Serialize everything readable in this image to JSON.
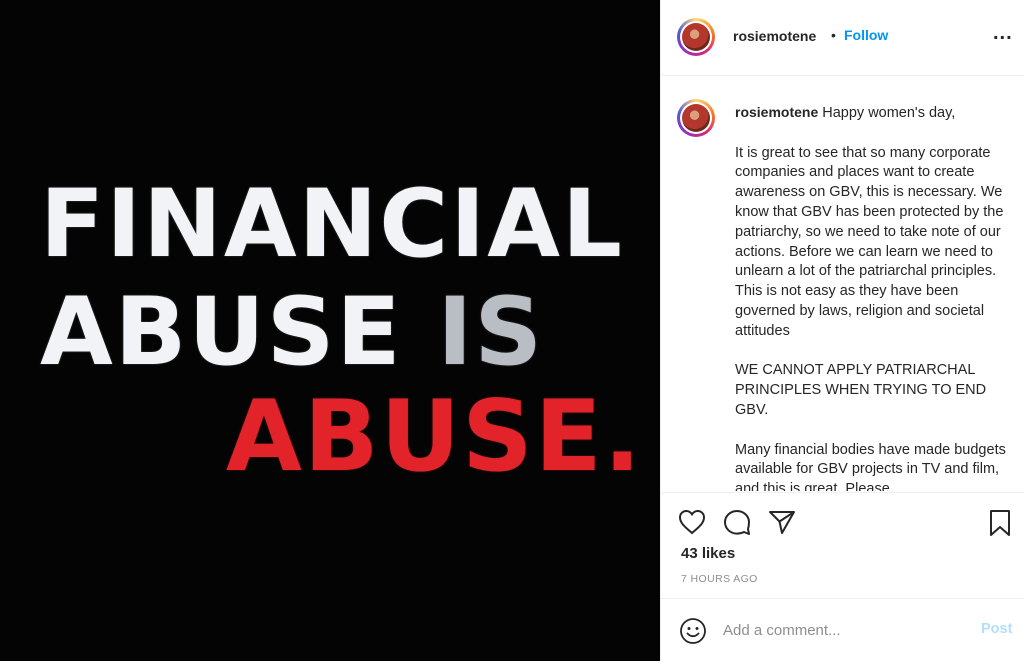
{
  "post_image": {
    "line1": "FINANCIAL",
    "line2_a": "ABUSE ",
    "line2_b": "IS",
    "line3": "ABUSE."
  },
  "header": {
    "username": "rosiemotene",
    "separator": "•",
    "follow_label": "Follow",
    "more_label": "..."
  },
  "caption": {
    "username": "rosiemotene",
    "paragraphs": [
      "Happy women's day,",
      "It is great to see that so many corporate companies and places want to create awareness on GBV, this is necessary. We know that GBV has been protected by the patriarchy, so we need to take note of our actions. Before we can learn we need to unlearn a lot of the patriarchal principles. This is not easy as they have been governed by laws, religion and societal attitudes",
      "WE CANNOT APPLY PATRIARCHAL PRINCIPLES WHEN TRYING TO END GBV.",
      "Many financial bodies have made budgets available for GBV projects in TV and film, and this is great. Please"
    ]
  },
  "actions": {
    "likes": "43 likes",
    "timestamp": "7 HOURS AGO",
    "icons": [
      "heart-icon",
      "comment-icon",
      "share-icon",
      "bookmark-icon"
    ]
  },
  "comment_bar": {
    "placeholder": "Add a comment...",
    "post_label": "Post"
  },
  "colors": {
    "accent": "#0095f6",
    "post_disabled": "#b2dffc",
    "headline_red": "#e2242a"
  }
}
